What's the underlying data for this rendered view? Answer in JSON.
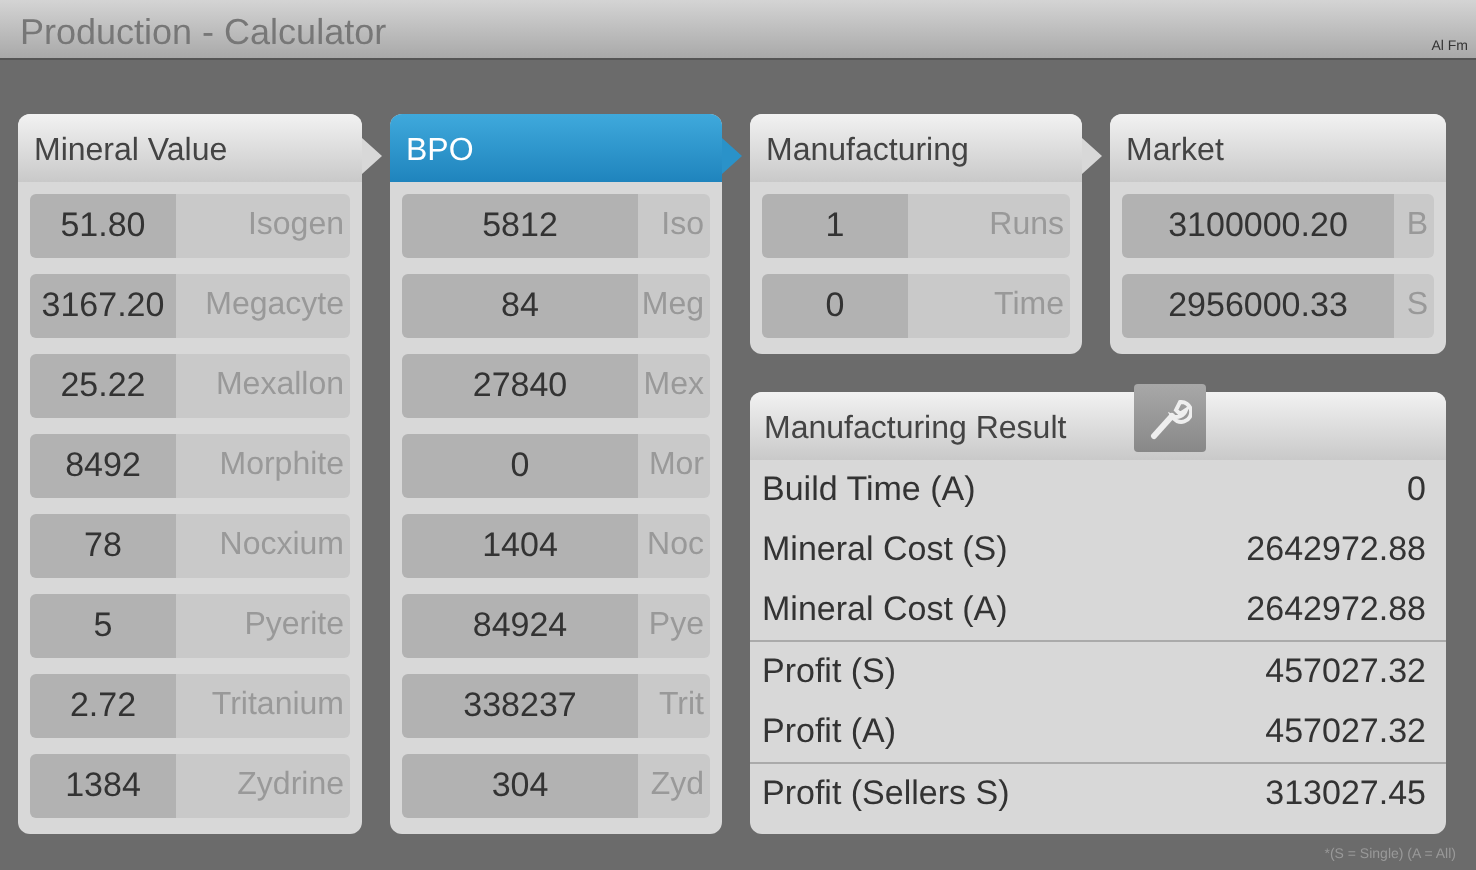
{
  "window": {
    "title": "Production - Calculator",
    "corner_text": "Al Fm"
  },
  "panels": [
    {
      "title": "Mineral Value",
      "selected": false,
      "rows": [
        {
          "value": "51.80",
          "label": "Isogen"
        },
        {
          "value": "3167.20",
          "label": "Megacyte"
        },
        {
          "value": "25.22",
          "label": "Mexallon"
        },
        {
          "value": "8492",
          "label": "Morphite"
        },
        {
          "value": "78",
          "label": "Nocxium"
        },
        {
          "value": "5",
          "label": "Pyerite"
        },
        {
          "value": "2.72",
          "label": "Tritanium"
        },
        {
          "value": "1384",
          "label": "Zydrine"
        }
      ]
    },
    {
      "title": "BPO",
      "selected": true,
      "rows": [
        {
          "value": "5812",
          "label": "Iso"
        },
        {
          "value": "84",
          "label": "Meg"
        },
        {
          "value": "27840",
          "label": "Mex"
        },
        {
          "value": "0",
          "label": "Mor"
        },
        {
          "value": "1404",
          "label": "Noc"
        },
        {
          "value": "84924",
          "label": "Pye"
        },
        {
          "value": "338237",
          "label": "Trit"
        },
        {
          "value": "304",
          "label": "Zyd"
        }
      ]
    },
    {
      "title": "Manufacturing",
      "selected": false,
      "rows": [
        {
          "value": "1",
          "label": "Runs"
        },
        {
          "value": "0",
          "label": "Time"
        }
      ]
    },
    {
      "title": "Market",
      "selected": false,
      "rows": [
        {
          "value": "3100000.20",
          "label": "B"
        },
        {
          "value": "2956000.33",
          "label": "S"
        }
      ]
    }
  ],
  "result": {
    "title": "Manufacturing Result",
    "groups": [
      [
        {
          "label": "Build Time (A)",
          "value": "0"
        },
        {
          "label": "Mineral Cost (S)",
          "value": "2642972.88"
        },
        {
          "label": "Mineral Cost (A)",
          "value": "2642972.88"
        }
      ],
      [
        {
          "label": "Profit (S)",
          "value": "457027.32"
        },
        {
          "label": "Profit (A)",
          "value": "457027.32"
        }
      ],
      [
        {
          "label": "Profit (Sellers S)",
          "value": "313027.45"
        }
      ]
    ]
  },
  "footnote": "*(S = Single) (A = All)"
}
